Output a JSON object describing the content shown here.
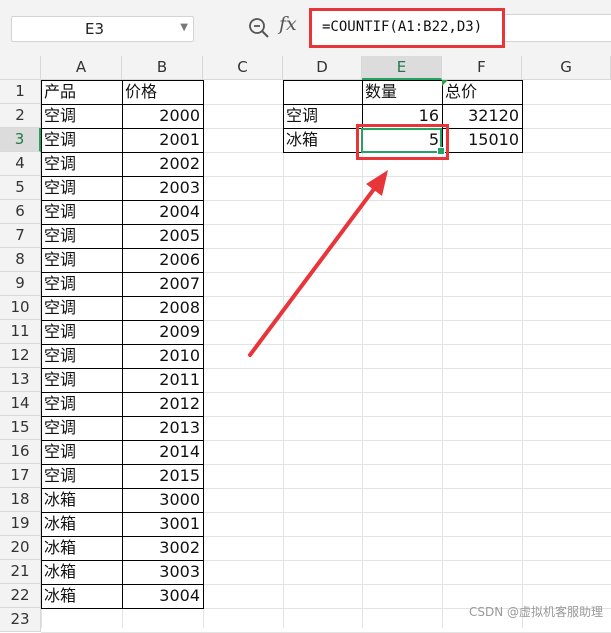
{
  "name_box": {
    "value": "E3"
  },
  "formula_bar": {
    "fx_label": "fx",
    "formula": "=COUNTIF(A1:B22,D3)"
  },
  "columns": [
    "A",
    "B",
    "C",
    "D",
    "E",
    "F",
    "G"
  ],
  "selected_column": "E",
  "rows": [
    "1",
    "2",
    "3",
    "4",
    "5",
    "6",
    "7",
    "8",
    "9",
    "10",
    "11",
    "12",
    "13",
    "14",
    "15",
    "16",
    "17",
    "18",
    "19",
    "20",
    "21",
    "22",
    "23"
  ],
  "selected_row": "3",
  "table_ab": {
    "header": [
      "产品",
      "价格"
    ],
    "rows": [
      [
        "空调",
        "2000"
      ],
      [
        "空调",
        "2001"
      ],
      [
        "空调",
        "2002"
      ],
      [
        "空调",
        "2003"
      ],
      [
        "空调",
        "2004"
      ],
      [
        "空调",
        "2005"
      ],
      [
        "空调",
        "2006"
      ],
      [
        "空调",
        "2007"
      ],
      [
        "空调",
        "2008"
      ],
      [
        "空调",
        "2009"
      ],
      [
        "空调",
        "2010"
      ],
      [
        "空调",
        "2011"
      ],
      [
        "空调",
        "2012"
      ],
      [
        "空调",
        "2013"
      ],
      [
        "空调",
        "2014"
      ],
      [
        "空调",
        "2015"
      ],
      [
        "冰箱",
        "3000"
      ],
      [
        "冰箱",
        "3001"
      ],
      [
        "冰箱",
        "3002"
      ],
      [
        "冰箱",
        "3003"
      ],
      [
        "冰箱",
        "3004"
      ]
    ]
  },
  "table_def": {
    "header": [
      "",
      "数量",
      "总价"
    ],
    "rows": [
      [
        "空调",
        "16",
        "32120"
      ],
      [
        "冰箱",
        "5",
        "15010"
      ]
    ]
  },
  "colors": {
    "accent_green": "#21a366",
    "highlight_red": "#e8353a"
  },
  "watermark": "CSDN @虚拟机客服助理"
}
